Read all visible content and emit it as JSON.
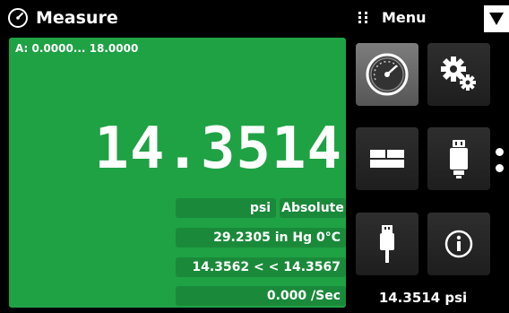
{
  "header": {
    "title": "Measure",
    "menu_label": "Menu"
  },
  "measure": {
    "range": "A: 0.0000... 18.0000",
    "reading": "14.3514",
    "units": "psi",
    "mode": "Absolute",
    "alt_units": "29.2305 in Hg 0°C",
    "peak": "14.3562 < < 14.3567",
    "rate": "0.000 /Sec"
  },
  "menu": {
    "tiles": [
      {
        "name": "measure",
        "icon": "gauge-icon",
        "selected": true
      },
      {
        "name": "settings",
        "icon": "gears-icon"
      },
      {
        "name": "display",
        "icon": "display-icon"
      },
      {
        "name": "sensor",
        "icon": "sensor-icon"
      },
      {
        "name": "usb",
        "icon": "usb-icon"
      },
      {
        "name": "info",
        "icon": "info-icon"
      }
    ]
  },
  "status": {
    "reading": "14.3514 psi"
  },
  "colors": {
    "panel": "#1fa244",
    "chip": "#1a8a3a",
    "tile": "#2a2a2a",
    "tile_selected": "#6e6e6e"
  }
}
